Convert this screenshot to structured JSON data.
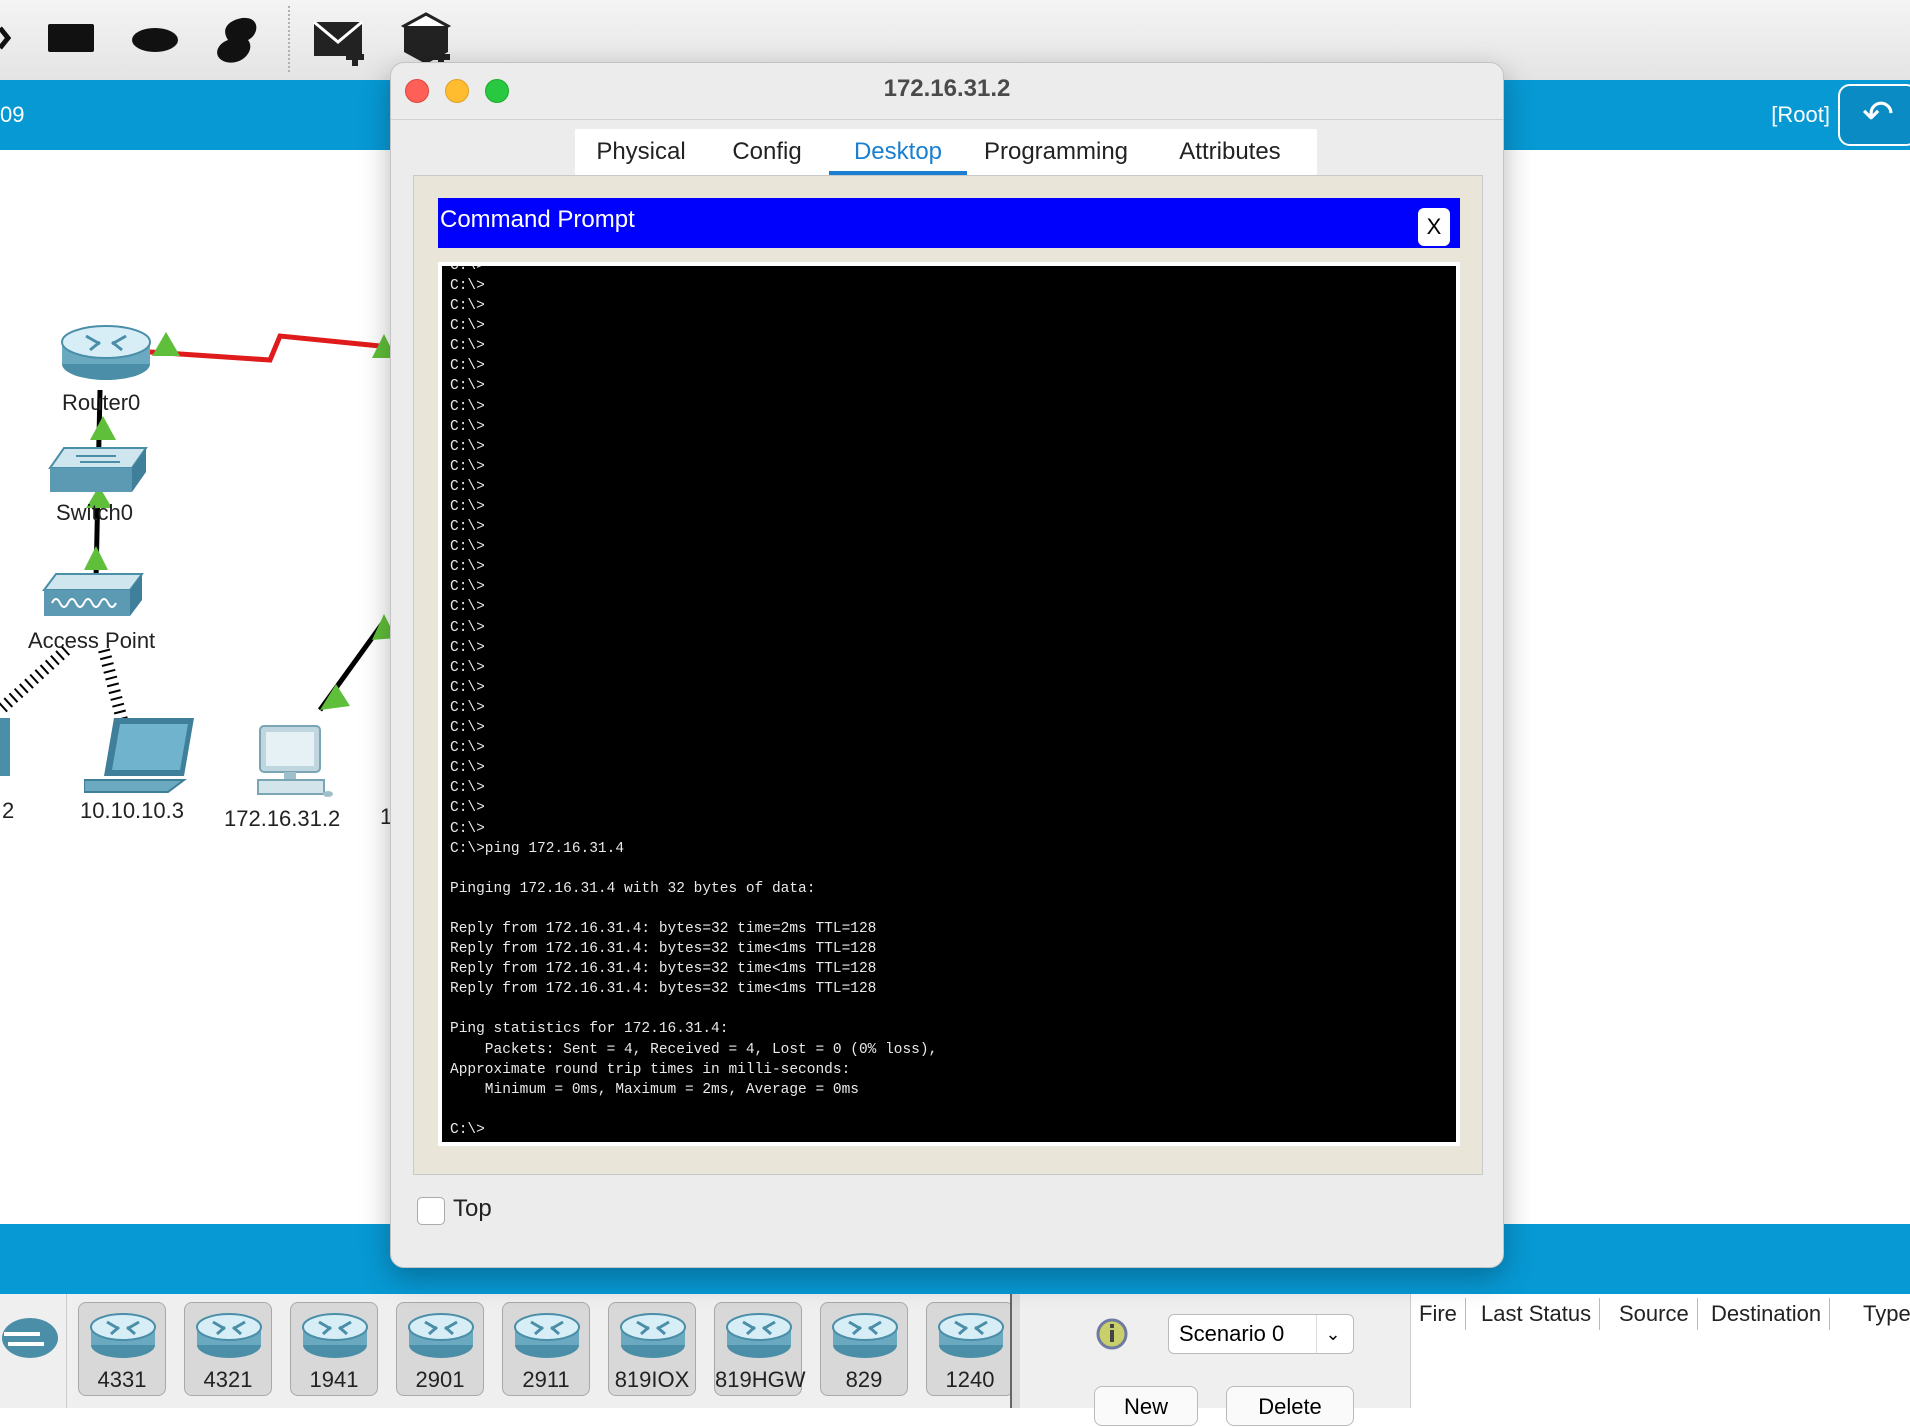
{
  "toolbar": {
    "icons": [
      "rectangle-tool-icon",
      "ellipse-tool-icon",
      "freeform-tool-icon",
      "add-simple-pdu-icon",
      "add-complex-pdu-icon"
    ]
  },
  "topbar": {
    "left_text": "09",
    "root_label": "[Root]"
  },
  "workspace": {
    "devices": [
      {
        "label": "Router0"
      },
      {
        "label": "Switch0"
      },
      {
        "label": "Access Point"
      },
      {
        "label": "2"
      },
      {
        "label": "10.10.10.3"
      },
      {
        "label": "172.16.31.2"
      },
      {
        "label": "1"
      }
    ]
  },
  "window": {
    "title": "172.16.31.2",
    "tabs": [
      "Physical",
      "Config",
      "Desktop",
      "Programming",
      "Attributes"
    ],
    "active_tab": "Desktop",
    "command_prompt": {
      "title": "Command Prompt",
      "close_label": "X",
      "output": "C:\\>\nC:\\>\nC:\\>\nC:\\>\nC:\\>\nC:\\>\nC:\\>\nC:\\>\nC:\\>\nC:\\>\nC:\\>\nC:\\>\nC:\\>\nC:\\>\nC:\\>\nC:\\>\nC:\\>\nC:\\>\nC:\\>\nC:\\>\nC:\\>\nC:\\>\nC:\\>\nC:\\>\nC:\\>\nC:\\>\nC:\\>\nC:\\>\nC:\\>\nC:\\>ping 172.16.31.4\n\nPinging 172.16.31.4 with 32 bytes of data:\n\nReply from 172.16.31.4: bytes=32 time=2ms TTL=128\nReply from 172.16.31.4: bytes=32 time<1ms TTL=128\nReply from 172.16.31.4: bytes=32 time<1ms TTL=128\nReply from 172.16.31.4: bytes=32 time<1ms TTL=128\n\nPing statistics for 172.16.31.4:\n    Packets: Sent = 4, Received = 4, Lost = 0 (0% loss),\nApproximate round trip times in milli-seconds:\n    Minimum = 0ms, Maximum = 2ms, Average = 0ms\n\nC:\\>"
    },
    "top_checkbox": {
      "label": "Top",
      "checked": false
    }
  },
  "bottom_panel": {
    "device_models": [
      "4331",
      "4321",
      "1941",
      "2901",
      "2911",
      "819IOX",
      "819HGW",
      "829",
      "1240"
    ],
    "scenario": "Scenario 0",
    "new_label": "New",
    "delete_label": "Delete",
    "pdu_columns": [
      "Fire",
      "Last Status",
      "Source",
      "Destination",
      "Type"
    ]
  },
  "colors": {
    "accent_blue": "#0799d4",
    "cmd_header": "#0000fd",
    "link_red": "#e01b1b",
    "link_up_green": "#5fbf3a",
    "active_tab": "#1a7fd0"
  }
}
